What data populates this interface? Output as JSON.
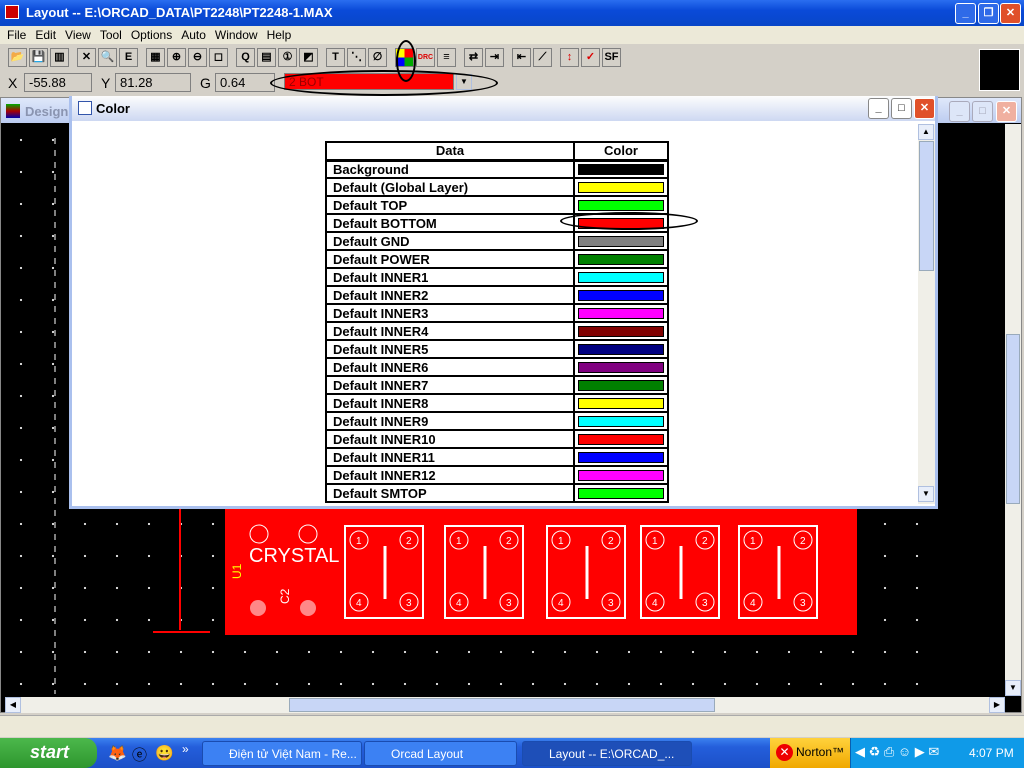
{
  "window": {
    "title": "Layout -- E:\\ORCAD_DATA\\PT2248\\PT2248-1.MAX"
  },
  "menu": [
    "File",
    "Edit",
    "View",
    "Tool",
    "Options",
    "Auto",
    "Window",
    "Help"
  ],
  "toolbar": [
    {
      "icon": "open-icon",
      "g": "📂"
    },
    {
      "icon": "save-icon",
      "g": "💾"
    },
    {
      "icon": "library-icon",
      "g": "▥"
    },
    {
      "icon": "cut-icon",
      "g": "✕"
    },
    {
      "icon": "find-icon",
      "g": "🔍"
    },
    {
      "icon": "edit-icon",
      "g": "E"
    },
    {
      "icon": "spreadsheet-icon",
      "g": "▦"
    },
    {
      "icon": "zoom-in-icon",
      "g": "⊕"
    },
    {
      "icon": "zoom-out-icon",
      "g": "⊖"
    },
    {
      "icon": "zoom-all-icon",
      "g": "◻"
    },
    {
      "icon": "query-icon",
      "g": "Q"
    },
    {
      "icon": "component-icon",
      "g": "▤"
    },
    {
      "icon": "pin-icon",
      "g": "①"
    },
    {
      "icon": "obstacle-icon",
      "g": "◩"
    },
    {
      "icon": "text-icon",
      "g": "T"
    },
    {
      "icon": "connection-icon",
      "g": "⋱"
    },
    {
      "icon": "error-icon",
      "g": "∅"
    },
    {
      "icon": "color-icon",
      "g": "▦"
    },
    {
      "icon": "drc-icon",
      "g": "DRC"
    },
    {
      "icon": "layers-icon",
      "g": "≡"
    },
    {
      "icon": "route-icon",
      "g": "⇄"
    },
    {
      "icon": "shove-icon",
      "g": "⇥"
    },
    {
      "icon": "reconnect-icon",
      "g": "⇤"
    },
    {
      "icon": "auto-route-icon",
      "g": "⟋"
    },
    {
      "icon": "refresh-icon",
      "g": "↕"
    },
    {
      "icon": "drc-check-icon",
      "g": "✓"
    },
    {
      "icon": "sf-icon",
      "g": "SF"
    }
  ],
  "coords": {
    "x_label": "X",
    "x": "-55.88",
    "y_label": "Y",
    "y": "81.28",
    "g_label": "G",
    "g": "0.64",
    "layer": "2  BOT"
  },
  "design_window": {
    "title": "Design"
  },
  "color_window": {
    "title": "Color",
    "headers": [
      "Data",
      "Color"
    ],
    "rows": [
      {
        "name": "Background",
        "color": "#000000"
      },
      {
        "name": "Default (Global Layer)",
        "color": "#ffff00"
      },
      {
        "name": "Default TOP",
        "color": "#00ff00"
      },
      {
        "name": "Default BOTTOM",
        "color": "#ff0000"
      },
      {
        "name": "Default GND",
        "color": "#808080"
      },
      {
        "name": "Default POWER",
        "color": "#008000"
      },
      {
        "name": "Default INNER1",
        "color": "#00ffff"
      },
      {
        "name": "Default INNER2",
        "color": "#0000ff"
      },
      {
        "name": "Default INNER3",
        "color": "#ff00ff"
      },
      {
        "name": "Default INNER4",
        "color": "#800000"
      },
      {
        "name": "Default INNER5",
        "color": "#000080"
      },
      {
        "name": "Default INNER6",
        "color": "#800080"
      },
      {
        "name": "Default INNER7",
        "color": "#008000"
      },
      {
        "name": "Default INNER8",
        "color": "#ffff00"
      },
      {
        "name": "Default INNER9",
        "color": "#00ffff"
      },
      {
        "name": "Default INNER10",
        "color": "#ff0000"
      },
      {
        "name": "Default INNER11",
        "color": "#0000ff"
      },
      {
        "name": "Default INNER12",
        "color": "#ff00ff"
      },
      {
        "name": "Default SMTOP",
        "color": "#00ff00"
      }
    ]
  },
  "pcb": {
    "label": "CRYSTAL",
    "ref_u1": "U1",
    "ref_c2": "C2",
    "pads": [
      "1",
      "2",
      "3",
      "4"
    ]
  },
  "taskbar": {
    "start": "start",
    "tasks": [
      "Điện tử Việt Nam - Re...",
      "Orcad Layout",
      "Layout -- E:\\ORCAD_..."
    ],
    "norton": "Norton™",
    "clock": "4:07 PM"
  }
}
